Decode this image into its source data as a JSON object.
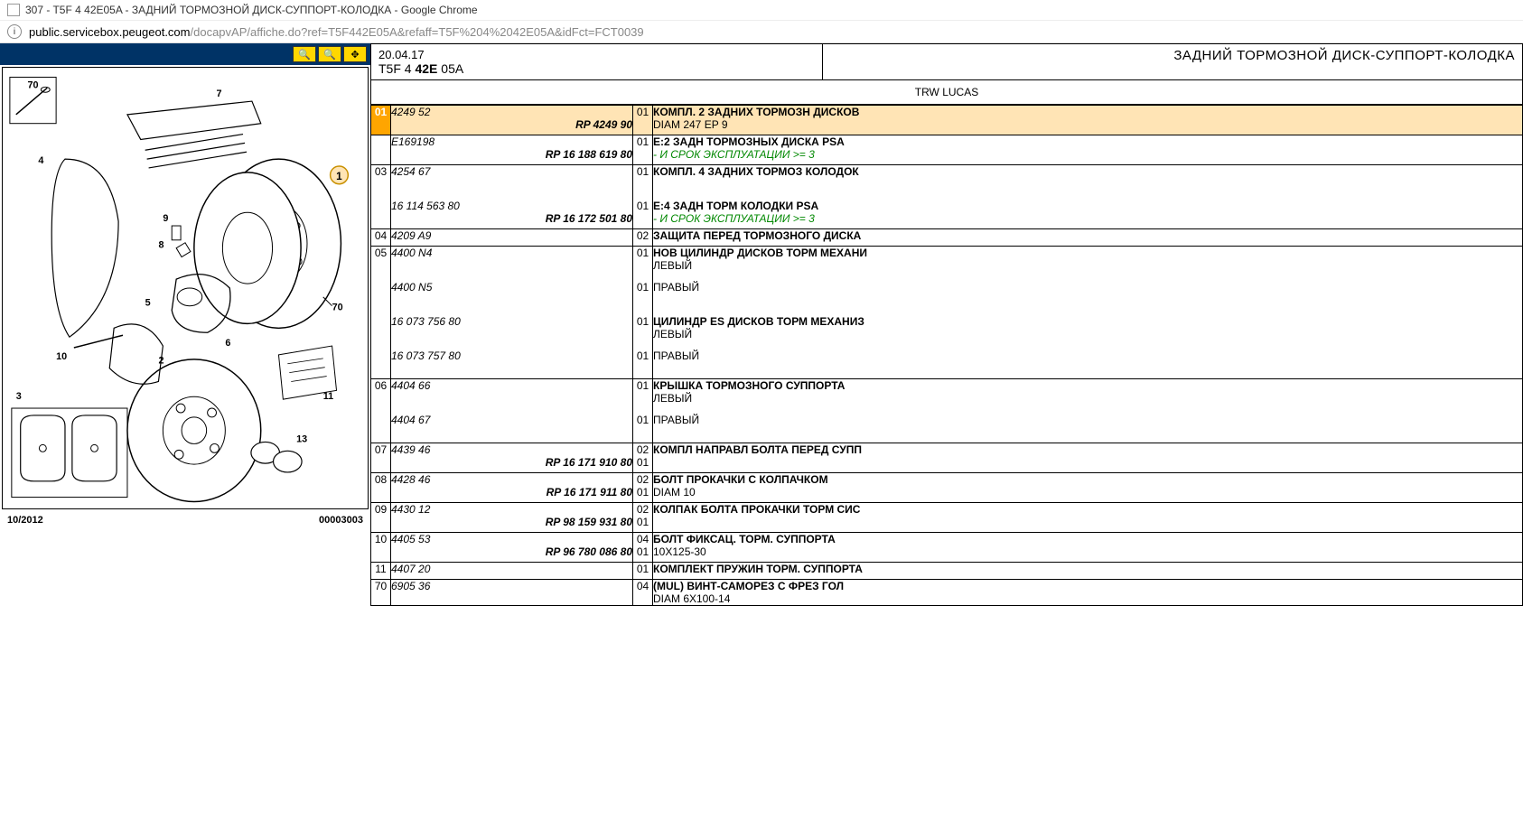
{
  "browser": {
    "tab_title": "307 - T5F 4 42E05A - ЗАДНИЙ ТОРМОЗНОЙ ДИСК-СУППОРТ-КОЛОДКА - Google Chrome",
    "url_domain": "public.servicebox.peugeot.com",
    "url_path": "/docapvAP/affiche.do?ref=T5F442E05A&refaff=T5F%204%2042E05A&idFct=FCT0039"
  },
  "diagram": {
    "date": "10/2012",
    "code": "00003003",
    "callouts": [
      "70",
      "7",
      "1",
      "4",
      "9",
      "8",
      "70",
      "5",
      "10",
      "2",
      "6",
      "3",
      "11",
      "13"
    ]
  },
  "header": {
    "date": "20.04.17",
    "code_prefix": "T5F 4 ",
    "code_bold": "42E",
    "code_suffix": " 05A",
    "title": "ЗАДНИЙ ТОРМОЗНОЙ ДИСК-СУППОРТ-КОЛОДКА"
  },
  "supplier": "TRW LUCAS",
  "parts": [
    {
      "num": "01",
      "highlighted": true,
      "refs": [
        {
          "main": "4249 52",
          "rp": "RP 4249 90",
          "qty": "01"
        }
      ],
      "qty_top": "01",
      "desc": "КОМПЛ. 2 ЗАДНИХ ТОРМОЗН ДИСКОВ",
      "sub": "DIAM 247 EP 9"
    },
    {
      "num": "",
      "refs": [
        {
          "main": "E169198",
          "rp": "RP 16 188 619 80",
          "qty": "01"
        }
      ],
      "qty_top": "01",
      "desc": "E:2 ЗАДН ТОРМОЗНЫХ ДИСКА PSA",
      "green": "- И СРОК ЭКСПЛУАТАЦИИ >= 3"
    },
    {
      "num": "03",
      "refs": [
        {
          "main": "4254 67",
          "rp": "",
          "qty": "01"
        },
        {
          "main": "16 114 563 80",
          "rp": "RP 16 172 501 80",
          "qty": "01"
        }
      ],
      "desc_lines": [
        {
          "desc": "КОМПЛ. 4 ЗАДНИХ ТОРМОЗ КОЛОДОК",
          "sub": ""
        },
        {
          "desc": "E:4 ЗАДН ТОРМ КОЛОДКИ PSA",
          "green": "- И СРОК ЭКСПЛУАТАЦИИ >= 3"
        }
      ]
    },
    {
      "num": "04",
      "refs": [
        {
          "main": "4209 A9",
          "rp": "",
          "qty": "02"
        }
      ],
      "desc": "ЗАЩИТА ПЕРЕД ТОРМОЗНОГО ДИСКА"
    },
    {
      "num": "05",
      "refs": [
        {
          "main": "4400 N4",
          "qty": "01"
        },
        {
          "main": "4400 N5",
          "qty": "01"
        },
        {
          "main": "16 073 756 80",
          "qty": "01"
        },
        {
          "main": "16 073 757 80",
          "qty": "01"
        }
      ],
      "desc_lines": [
        {
          "desc": "НОВ ЦИЛИНДР ДИСКОВ ТОРМ МЕХАНИ",
          "sub": "ЛЕВЫЙ"
        },
        {
          "desc": "",
          "sub": "ПРАВЫЙ"
        },
        {
          "desc": "ЦИЛИНДР ES ДИСКОВ ТОРМ МЕХАНИЗ",
          "sub": "ЛЕВЫЙ"
        },
        {
          "desc": "",
          "sub": "ПРАВЫЙ"
        }
      ]
    },
    {
      "num": "06",
      "refs": [
        {
          "main": "4404 66",
          "qty": "01"
        },
        {
          "main": "4404 67",
          "qty": "01"
        }
      ],
      "desc_lines": [
        {
          "desc": "КРЫШКА ТОРМОЗНОГО СУППОРТА",
          "sub": "ЛЕВЫЙ"
        },
        {
          "desc": "",
          "sub": "ПРАВЫЙ"
        }
      ]
    },
    {
      "num": "07",
      "refs": [
        {
          "main": "4439 46",
          "rp": "RP 16 171 910 80",
          "qty": "02",
          "qty2": "01"
        }
      ],
      "desc": "КОМПЛ НАПРАВЛ БОЛТА ПЕРЕД СУПП"
    },
    {
      "num": "08",
      "refs": [
        {
          "main": "4428 46",
          "rp": "RP 16 171 911 80",
          "qty": "02",
          "qty2": "01"
        }
      ],
      "desc": "БОЛТ ПРОКАЧКИ С КОЛПАЧКОМ",
      "sub": "DIAM 10"
    },
    {
      "num": "09",
      "refs": [
        {
          "main": "4430 12",
          "rp": "RP 98 159 931 80",
          "qty": "02",
          "qty2": "01"
        }
      ],
      "desc": "КОЛПАК БОЛТА ПРОКАЧКИ ТОРМ СИС"
    },
    {
      "num": "10",
      "refs": [
        {
          "main": "4405 53",
          "rp": "RP 96 780 086 80",
          "qty": "04",
          "qty2": "01"
        }
      ],
      "desc": "БОЛТ ФИКСАЦ. ТОРМ. СУППОРТА",
      "sub": "10X125-30"
    },
    {
      "num": "11",
      "refs": [
        {
          "main": "4407 20",
          "qty": "01"
        }
      ],
      "desc": "КОМПЛЕКТ ПРУЖИН ТОРМ. СУППОРТА"
    },
    {
      "num": "70",
      "refs": [
        {
          "main": "6905 36",
          "qty": "04"
        }
      ],
      "desc": "(MUL) ВИНТ-САМОРЕЗ С ФРЕЗ ГОЛ",
      "sub": "DIAM 6X100-14"
    }
  ]
}
